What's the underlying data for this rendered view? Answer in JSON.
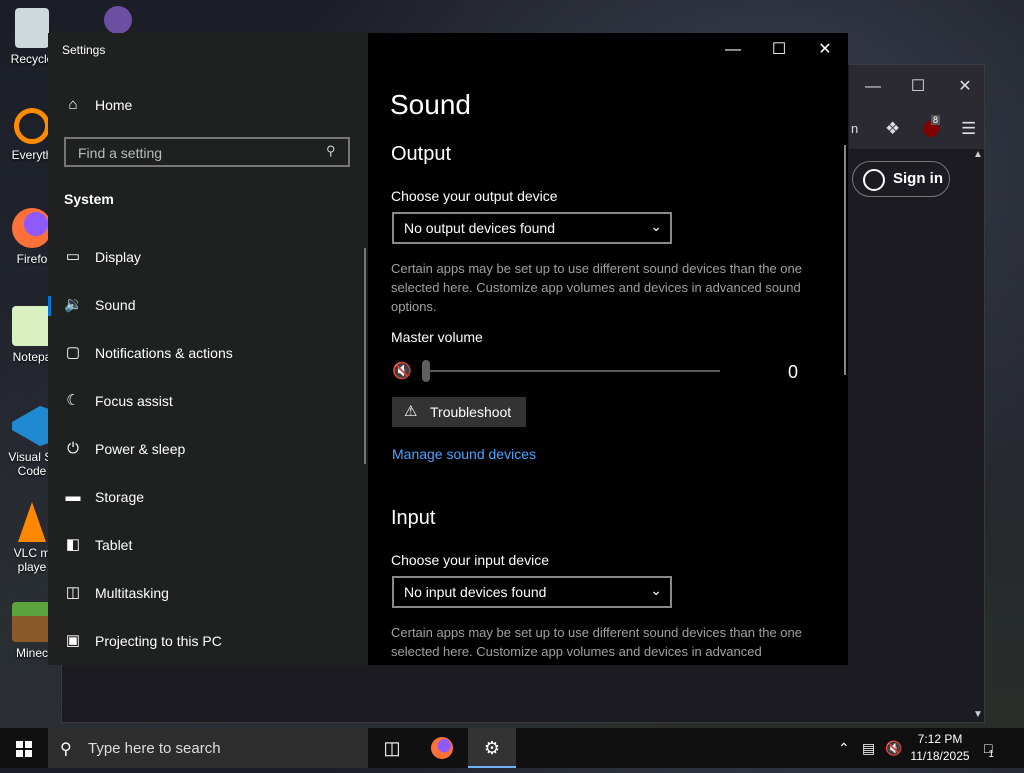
{
  "desktop": {
    "icons": [
      {
        "label": "Recycle"
      },
      {
        "label": "Everyth"
      },
      {
        "label": "Firefo"
      },
      {
        "label": "Notepa"
      },
      {
        "label": "Visual St Code"
      },
      {
        "label": "VLC m playe"
      },
      {
        "label": "Minec"
      }
    ]
  },
  "browser": {
    "sign_in_label": "Sign in",
    "badge_count": "8"
  },
  "settings": {
    "window_title": "Settings",
    "nav": {
      "home_label": "Home",
      "search_placeholder": "Find a setting",
      "section_title": "System",
      "items": [
        {
          "label": "Display",
          "icon": "monitor-icon"
        },
        {
          "label": "Sound",
          "icon": "speaker-icon"
        },
        {
          "label": "Notifications & actions",
          "icon": "notification-icon"
        },
        {
          "label": "Focus assist",
          "icon": "moon-icon"
        },
        {
          "label": "Power & sleep",
          "icon": "power-icon"
        },
        {
          "label": "Storage",
          "icon": "storage-icon"
        },
        {
          "label": "Tablet",
          "icon": "tablet-icon"
        },
        {
          "label": "Multitasking",
          "icon": "multitasking-icon"
        },
        {
          "label": "Projecting to this PC",
          "icon": "projector-icon"
        }
      ],
      "selected": "Sound"
    },
    "content": {
      "page_title": "Sound",
      "output": {
        "heading": "Output",
        "device_label": "Choose your output device",
        "device_value": "No output devices found",
        "description": "Certain apps may be set up to use different sound devices than the one selected here. Customize app volumes and devices in advanced sound options.",
        "volume_label": "Master volume",
        "volume_value": "0",
        "volume_level": 0,
        "troubleshoot_label": "Troubleshoot",
        "manage_link": "Manage sound devices"
      },
      "input": {
        "heading": "Input",
        "device_label": "Choose your input device",
        "device_value": "No input devices found",
        "description": "Certain apps may be set up to use different sound devices than the one selected here. Customize app volumes and devices in advanced"
      }
    }
  },
  "taskbar": {
    "search_placeholder": "Type here to search",
    "time": "7:12 PM",
    "date": "11/18/2025",
    "notification_count": "1"
  },
  "colors": {
    "accent": "#0078d7",
    "link": "#4aa3ff"
  }
}
